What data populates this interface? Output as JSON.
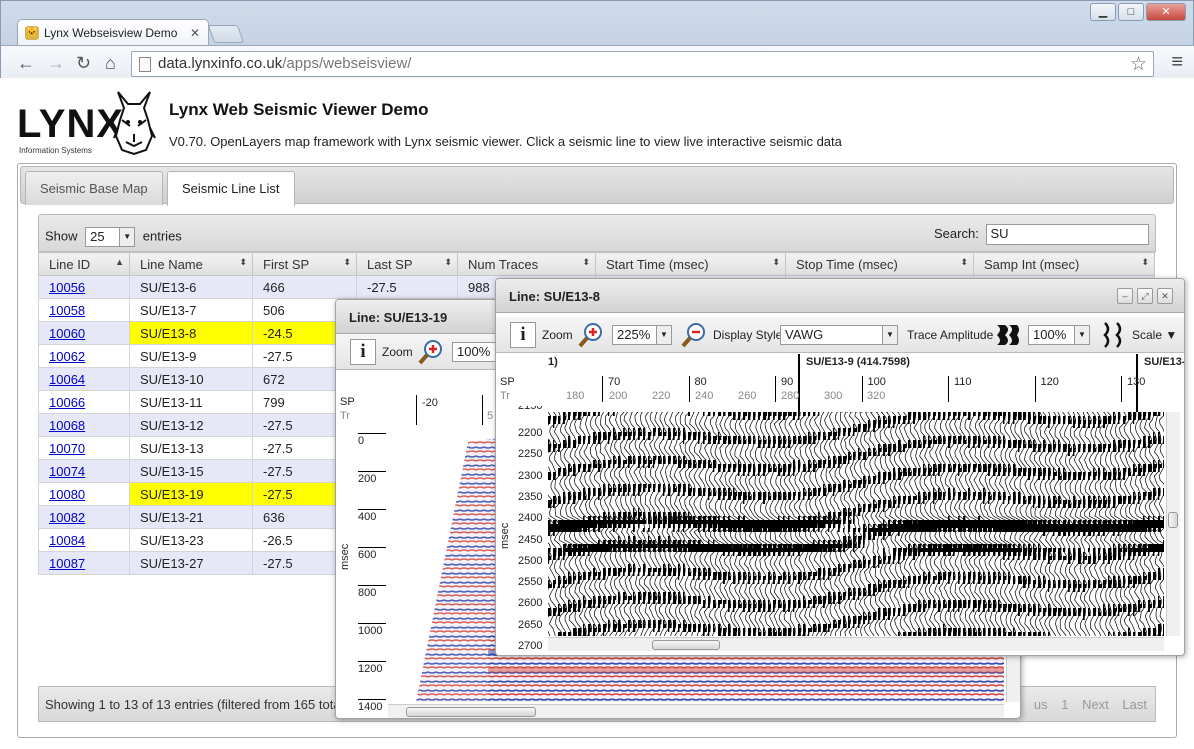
{
  "browser": {
    "tab_title": "Lynx Webseisview Demo",
    "url_host": "data.lynxinfo.co.uk",
    "url_path": "/apps/webseisview/",
    "win_min": "▁",
    "win_max": "□",
    "win_close": "✕"
  },
  "header": {
    "logo_text": "LYNX",
    "logo_small": "Information Systems",
    "title": "Lynx Web Seismic Viewer Demo",
    "subtitle": "V0.70. OpenLayers map framework with Lynx seismic viewer. Click a seismic line to view live interactive seismic data"
  },
  "tabs": [
    {
      "label": "Seismic Base Map",
      "active": false
    },
    {
      "label": "Seismic Line List",
      "active": true
    }
  ],
  "table": {
    "show_label": "Show",
    "entries_value": "25",
    "entries_label": "entries",
    "search_label": "Search:",
    "search_value": "SU",
    "columns": [
      "Line ID",
      "Line Name",
      "First SP",
      "Last SP",
      "Num Traces",
      "Start Time (msec)",
      "Stop Time (msec)",
      "Samp Int (msec)"
    ],
    "rows": [
      {
        "id": "10056",
        "name": "SU/E13-6",
        "first": "466",
        "last": "-27.5",
        "traces": "988",
        "hl": false
      },
      {
        "id": "10058",
        "name": "SU/E13-7",
        "first": "506",
        "last": "",
        "traces": "",
        "hl": false
      },
      {
        "id": "10060",
        "name": "SU/E13-8",
        "first": "-24.5",
        "last": "",
        "traces": "",
        "hl": true
      },
      {
        "id": "10062",
        "name": "SU/E13-9",
        "first": "-27.5",
        "last": "",
        "traces": "",
        "hl": false
      },
      {
        "id": "10064",
        "name": "SU/E13-10",
        "first": "672",
        "last": "",
        "traces": "",
        "hl": false
      },
      {
        "id": "10066",
        "name": "SU/E13-11",
        "first": "799",
        "last": "",
        "traces": "",
        "hl": false
      },
      {
        "id": "10068",
        "name": "SU/E13-12",
        "first": "-27.5",
        "last": "",
        "traces": "",
        "hl": false
      },
      {
        "id": "10070",
        "name": "SU/E13-13",
        "first": "-27.5",
        "last": "",
        "traces": "",
        "hl": false
      },
      {
        "id": "10074",
        "name": "SU/E13-15",
        "first": "-27.5",
        "last": "",
        "traces": "",
        "hl": false
      },
      {
        "id": "10080",
        "name": "SU/E13-19",
        "first": "-27.5",
        "last": "",
        "traces": "",
        "hl": true
      },
      {
        "id": "10082",
        "name": "SU/E13-21",
        "first": "636",
        "last": "",
        "traces": "",
        "hl": false
      },
      {
        "id": "10084",
        "name": "SU/E13-23",
        "first": "-26.5",
        "last": "",
        "traces": "",
        "hl": false
      },
      {
        "id": "10087",
        "name": "SU/E13-27",
        "first": "-27.5",
        "last": "",
        "traces": "",
        "hl": false
      }
    ],
    "info": "Showing 1 to 13 of 13 entries (filtered from 165 tota",
    "pager": [
      "us",
      "1",
      "Next",
      "Last"
    ]
  },
  "dialog_back": {
    "title": "Line: SU/E13-19",
    "info_label": "i",
    "zoom_label": "Zoom",
    "zoom_value": "100%",
    "sp_label": "SP",
    "tr_label": "Tr",
    "sp_first": "-20",
    "sp_second": "5",
    "msec_label": "msec",
    "time_ticks": [
      "0",
      "200",
      "400",
      "600",
      "800",
      "1000",
      "1200",
      "1400"
    ]
  },
  "dialog_front": {
    "title": "Line: SU/E13-8",
    "info_label": "i",
    "zoom_label": "Zoom",
    "zoom_value": "225%",
    "display_style_label": "Display Style",
    "display_style_value": "VAWG",
    "trace_amplitude_label": "Trace Amplitude",
    "amplitude_value": "100%",
    "scale_label": "Scale ▼",
    "tie_left": "1)",
    "tie_mid": "SU/E13-9 (414.7598)",
    "tie_right": "SU/E13-",
    "sp_label": "SP",
    "tr_label": "Tr",
    "sp_ticks": [
      "70",
      "80",
      "90",
      "100",
      "110",
      "120",
      "130"
    ],
    "tr_ticks": [
      "180",
      "200",
      "220",
      "240",
      "260",
      "280",
      "300",
      "320"
    ],
    "msec_label": "msec",
    "time_ticks": [
      "2200",
      "2250",
      "2300",
      "2350",
      "2400",
      "2450",
      "2500",
      "2550",
      "2600",
      "2650",
      "2700"
    ],
    "time_top_partial": "2150"
  },
  "colors": {
    "highlight": "#ffff00",
    "link": "#0000cc",
    "row_odd": "#e6e8f7"
  }
}
